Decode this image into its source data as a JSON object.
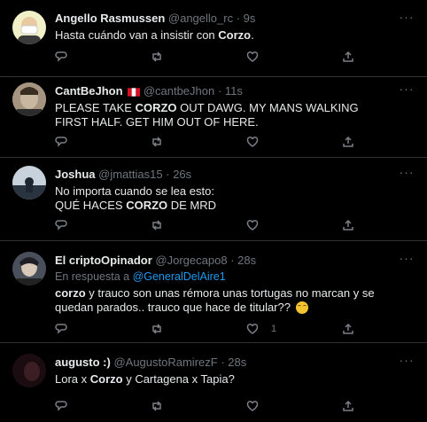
{
  "tweets": [
    {
      "name": "Angello Rasmussen",
      "handle": "@angello_rc",
      "dot": "·",
      "time": "9s",
      "body_pre": "Hasta cuándo van a insistir  con ",
      "body_bold": "Corzo",
      "body_post": "."
    },
    {
      "name": "CantBeJhon",
      "handle": "@cantbeJhon",
      "dot": "·",
      "time": "11s",
      "body_pre": "PLEASE TAKE ",
      "body_bold": "CORZO",
      "body_post": " OUT DAWG. MY MANS WALKING FIRST HALF. GET HIM OUT OF HERE."
    },
    {
      "name": "Joshua",
      "handle": "@jmattias15",
      "dot": "·",
      "time": "26s",
      "line1": "No importa cuando se lea esto:",
      "body_pre": "QUÉ HACES ",
      "body_bold": "CORZO",
      "body_post": " DE MRD"
    },
    {
      "name": "El criptoOpinador",
      "handle": "@Jorgecapo8",
      "dot": "·",
      "time": "28s",
      "reply_label": "En respuesta a ",
      "reply_handle": "@GeneralDelAire1",
      "body_bold": "corzo",
      "body_post": " y trauco son unas rémora unas tortugas no marcan y se quedan parados.. trauco que hace de titular??",
      "like_count": "1"
    },
    {
      "name": "augusto :)",
      "handle": "@AugustoRamirezF",
      "dot": "·",
      "time": "28s",
      "body_pre": "Lora x ",
      "body_bold": "Corzo",
      "body_post": " y Cartagena x Tapia?"
    }
  ],
  "icons": {
    "more": "more-icon",
    "reply": "reply-icon",
    "retweet": "retweet-icon",
    "like": "heart-icon",
    "share": "share-icon",
    "flag": "peru-flag-icon",
    "emoji": "flushed-emoji-icon"
  },
  "colors": {
    "background": "#000000",
    "accent": "#1d9bf0",
    "muted": "#6e767d",
    "divider": "#2f3336"
  }
}
